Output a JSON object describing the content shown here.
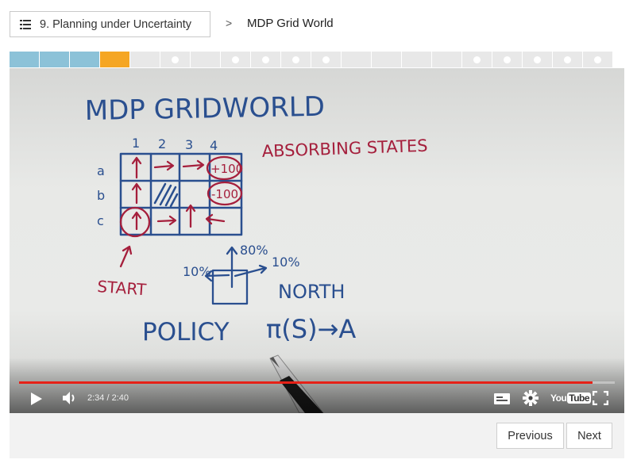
{
  "header": {
    "course_button_label": "9. Planning under Uncertainty",
    "separator": ">",
    "current_page": "MDP Grid World"
  },
  "progress": {
    "segments": [
      "done",
      "done",
      "done",
      "current",
      "todo",
      "dot",
      "todo",
      "dot",
      "dot",
      "dot",
      "dot",
      "todo",
      "todo",
      "todo",
      "todo",
      "dot",
      "dot",
      "dot",
      "dot",
      "dot"
    ]
  },
  "video": {
    "current_time": "2:34",
    "duration": "2:40",
    "time_display": "2:34 / 2:40",
    "played_fraction": 0.9625,
    "player_brand": "YouTube",
    "board": {
      "title": "MDP GRIDWORLD",
      "absorbing_label": "ABSORBING STATES",
      "col_labels": [
        "1",
        "2",
        "3",
        "4"
      ],
      "row_labels": [
        "a",
        "b",
        "c"
      ],
      "plus_reward": "+100",
      "minus_reward": "-100",
      "start_label": "START",
      "north_label": "NORTH",
      "pct_north": "80%",
      "pct_left": "10%",
      "pct_right": "10%",
      "policy_label": "POLICY",
      "policy_formula": "π(S)→A"
    }
  },
  "nav": {
    "previous_label": "Previous",
    "next_label": "Next"
  },
  "colors": {
    "progress_done": "#8cc2d8",
    "progress_current": "#f5a623",
    "ink_blue": "#2a4f8f",
    "ink_red": "#a51f3c",
    "scrub_played": "#e62117"
  }
}
